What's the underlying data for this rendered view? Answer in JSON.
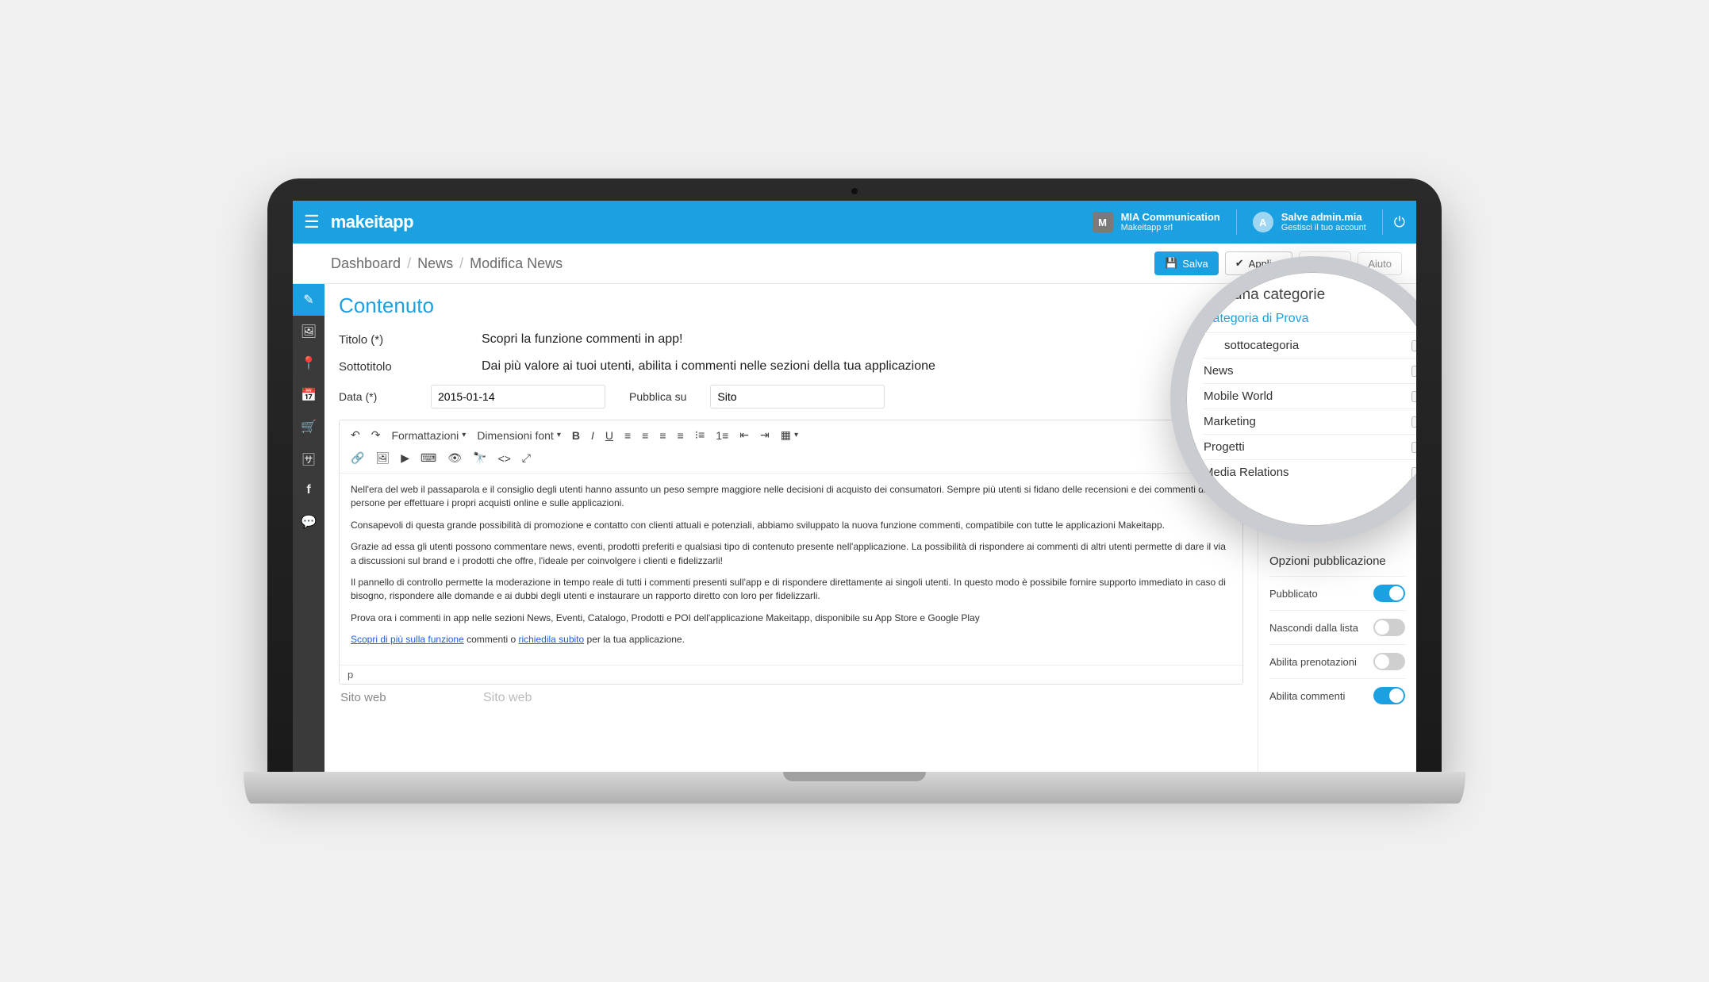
{
  "brand": "makeitapp",
  "header": {
    "org": {
      "avatar": "M",
      "name": "MIA Communication",
      "sub": "Makeitapp srl"
    },
    "user": {
      "avatar": "A",
      "name": "Salve admin.mia",
      "sub": "Gestisci il tuo account"
    }
  },
  "breadcrumb": {
    "items": [
      "Dashboard",
      "News",
      "Modifica News"
    ],
    "actions": {
      "save": "Salva",
      "apply": "Applica",
      "cancel_partial": "Ann",
      "help": "Aiuto"
    }
  },
  "form": {
    "section_title": "Contenuto",
    "title_label": "Titolo (*)",
    "title_value": "Scopri la funzione commenti in app!",
    "subtitle_label": "Sottotitolo",
    "subtitle_value": "Dai più valore ai tuoi utenti, abilita i commenti nelle sezioni della tua applicazione",
    "date_label": "Data (*)",
    "date_value": "2015-01-14",
    "publish_label": "Pubblica su",
    "publish_value": "Sito",
    "editor_dropdowns": {
      "format": "Formattazioni",
      "fontsize": "Dimensioni font"
    },
    "body_paragraphs": [
      "Nell'era del web il passaparola e il consiglio degli utenti hanno assunto un peso sempre maggiore nelle decisioni di acquisto dei consumatori. Sempre più utenti si fidano delle recensioni e dei commenti di altre persone per effettuare i propri acquisti online e sulle applicazioni.",
      "Consapevoli di questa grande possibilità di promozione e contatto con clienti attuali e potenziali, abbiamo sviluppato la nuova funzione commenti, compatibile con tutte le applicazioni Makeitapp.",
      "Grazie ad essa gli utenti possono commentare news, eventi, prodotti preferiti e qualsiasi tipo di contenuto presente nell'applicazione. La possibilità di rispondere ai commenti di altri utenti permette di dare il via a discussioni sul brand e i prodotti che offre, l'ideale per coinvolgere i clienti e fidelizzarli!",
      "Il pannello di controllo permette la moderazione in tempo reale di tutti i commenti presenti sull'app e di rispondere direttamente ai singoli utenti. In questo modo è possibile fornire supporto immediato in caso di bisogno, rispondere alle domande e ai dubbi degli utenti e instaurare un rapporto diretto con loro per fidelizzarli.",
      "Prova ora i commenti in app nelle sezioni News, Eventi, Catalogo, Prodotti e POI dell'applicazione Makeitapp, disponibile su App Store e Google Play"
    ],
    "body_link_line": {
      "link1": "Scopri di più sulla funzione",
      "mid": " commenti o ",
      "link2": "richiedila subito",
      "tail": " per la tua applicazione."
    },
    "status": "p",
    "site_label": "Sito web",
    "site_value": "Sito web"
  },
  "rightcol": {
    "partial_heading": "Se",
    "publish_heading": "Opzioni pubblicazione",
    "options": [
      {
        "label": "Pubblicato",
        "on": true
      },
      {
        "label": "Nascondi dalla lista",
        "on": false
      },
      {
        "label": "Abilita prenotazioni",
        "on": false
      },
      {
        "label": "Abilita commenti",
        "on": true
      }
    ]
  },
  "magnifier": {
    "heading_partial": "una categorie",
    "cat_head": "Categoria di Prova",
    "items": [
      {
        "label": "sottocategoria",
        "child": true
      },
      {
        "label": "News",
        "child": false
      },
      {
        "label": "Mobile World",
        "child": false
      },
      {
        "label": "Marketing",
        "child": false
      },
      {
        "label": "Progetti",
        "child": false
      },
      {
        "label": "Media Relations",
        "child": false
      }
    ]
  }
}
